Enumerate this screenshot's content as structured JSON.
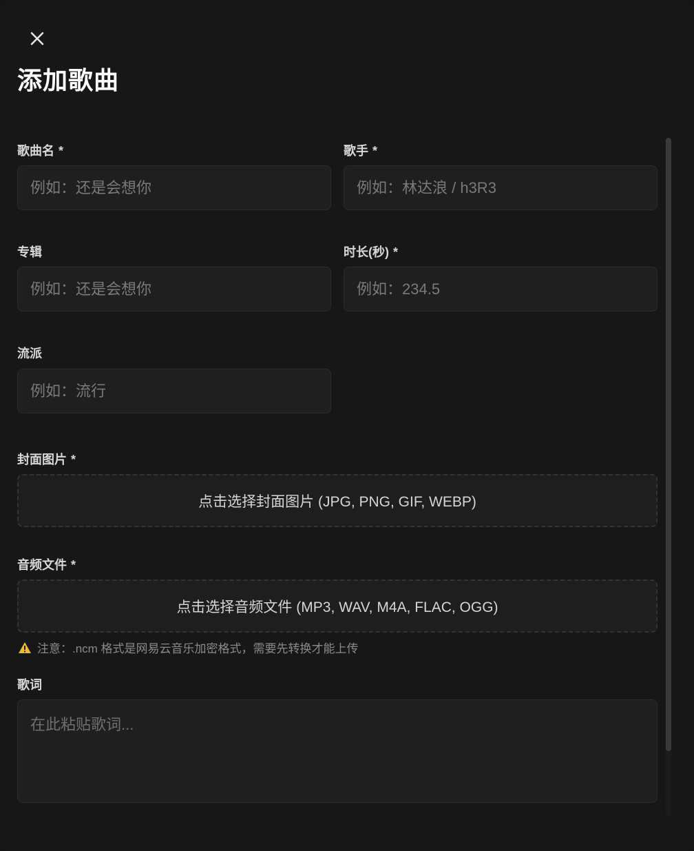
{
  "dialog": {
    "title": "添加歌曲",
    "close_icon": "close-icon"
  },
  "form": {
    "song_name": {
      "label": "歌曲名",
      "required": "*",
      "placeholder": "例如：还是会想你",
      "value": ""
    },
    "artist": {
      "label": "歌手",
      "required": "*",
      "placeholder": "例如：林达浪 / h3R3",
      "value": ""
    },
    "album": {
      "label": "专辑",
      "placeholder": "例如：还是会想你",
      "value": ""
    },
    "duration": {
      "label": "时长(秒)",
      "required": "*",
      "placeholder": "例如：234.5",
      "value": ""
    },
    "genre": {
      "label": "流派",
      "placeholder": "例如：流行",
      "value": ""
    },
    "cover": {
      "label": "封面图片",
      "required": "*",
      "button_text": "点击选择封面图片 (JPG, PNG, GIF, WEBP)"
    },
    "audio": {
      "label": "音频文件",
      "required": "*",
      "button_text": "点击选择音频文件 (MP3, WAV, M4A, FLAC, OGG)",
      "note": "注意：.ncm 格式是网易云音乐加密格式，需要先转换才能上传",
      "note_icon": "warning-icon"
    },
    "lyrics": {
      "label": "歌词",
      "placeholder": "在此粘贴歌词...",
      "value": ""
    }
  },
  "colors": {
    "background": "#171717",
    "input_bg": "#1f1f1f",
    "warning": "#f5b82e"
  }
}
